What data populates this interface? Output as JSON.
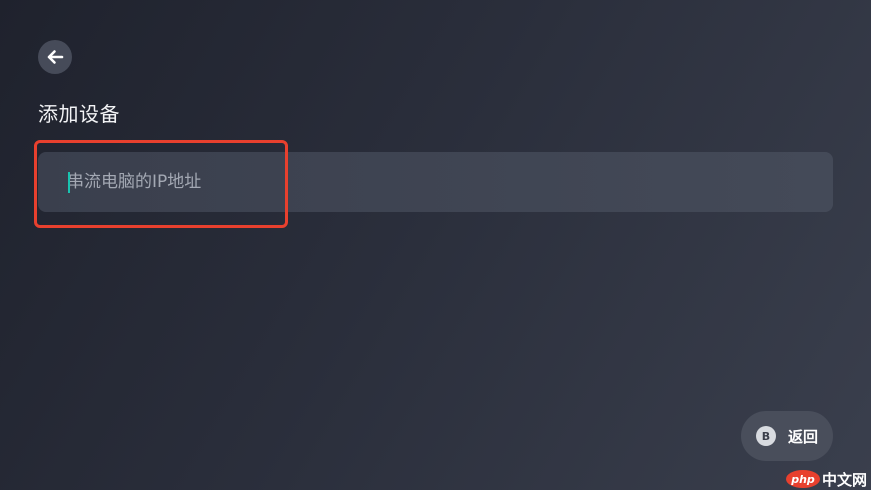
{
  "header": {
    "back_icon": "arrow-left-icon",
    "title": "添加设备"
  },
  "form": {
    "ip_input": {
      "value": "",
      "placeholder": "串流电脑的IP地址",
      "caret_color": "#19c3b0"
    },
    "highlight_color": "#e8402e"
  },
  "footer": {
    "return_button": {
      "key_hint": "B",
      "label": "返回"
    }
  },
  "watermark": {
    "logo_text": "php",
    "text": "中文网"
  }
}
